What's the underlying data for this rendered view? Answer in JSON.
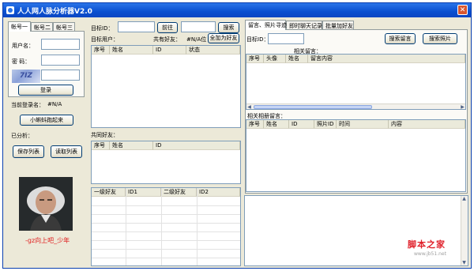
{
  "window": {
    "title": "人人网人脉分析器V2.0",
    "close_glyph": "✕"
  },
  "account_tabs": [
    "帐号一",
    "帐号二",
    "帐号三"
  ],
  "login": {
    "username_label": "用户名：",
    "password_label": "密  码：",
    "captcha_text": "7IZ",
    "login_button": "登录"
  },
  "current_login": {
    "label": "当前登录名：",
    "value": "#N/A"
  },
  "minigame_button": "小蝌蚪跑起来",
  "analyzed": {
    "label": "已分析：",
    "save_button": "保存列表",
    "read_button": "读取列表"
  },
  "motto": "-gz向上吧_少年",
  "target": {
    "id_label": "目标ID：",
    "go_button": "前往",
    "search_button": "搜索",
    "user_label": "目标用户：",
    "common_friends_label": "共有好友：",
    "common_friends_value": "#N/A位",
    "add_all_button": "全加为好友"
  },
  "target_table": {
    "columns": [
      "序号",
      "姓名",
      "ID",
      "状态"
    ]
  },
  "common_friends": {
    "label": "共同好友：",
    "columns": [
      "序号",
      "姓名",
      "ID"
    ]
  },
  "degree_table": {
    "columns": [
      "一级好友",
      "ID1",
      "二级好友",
      "ID2"
    ]
  },
  "right_tabs": [
    "留言、照片寻迹",
    "即时聊天记录",
    "批量加好友"
  ],
  "trace": {
    "id_label": "目标ID：",
    "search_msg_button": "搜索留言",
    "search_photo_button": "搜索照片",
    "related_msg_label": "相关留言：",
    "msg_columns": [
      "序号",
      "头像",
      "姓名",
      "留言内容"
    ],
    "related_photo_label": "相关相册留言：",
    "photo_columns": [
      "序号",
      "姓名",
      "ID",
      "照片ID",
      "时间",
      "内容"
    ]
  },
  "watermark": {
    "line1": "脚本之家",
    "line2": "www.jb51.net"
  }
}
